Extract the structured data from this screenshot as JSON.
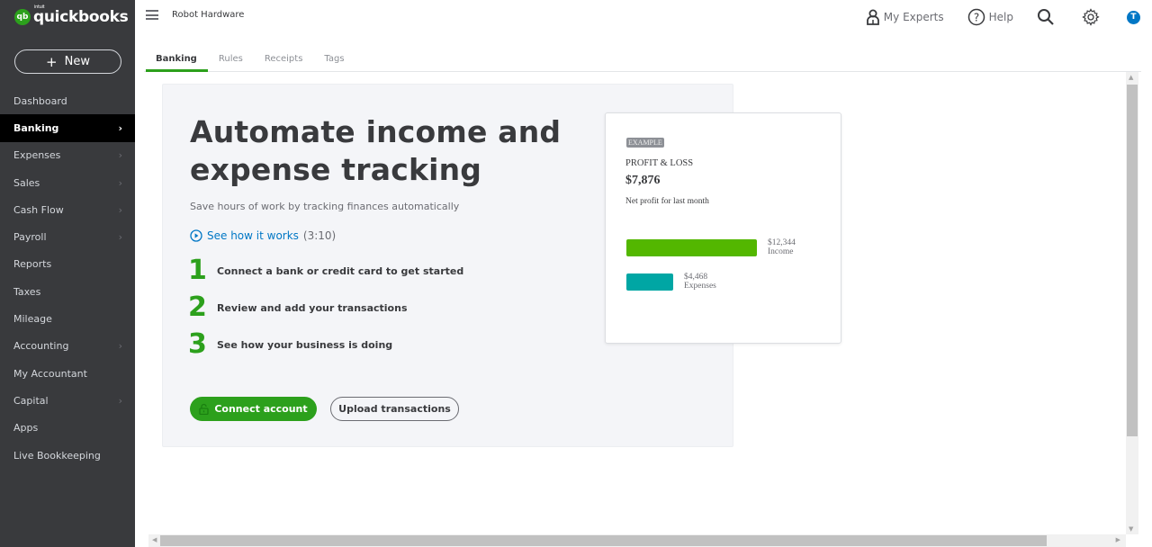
{
  "brand": {
    "logo_mark": "qb",
    "intuit": "intuit",
    "name": "quickbooks",
    "accent": "#2ca01c"
  },
  "sidebar": {
    "new_button": {
      "icon": "plus-icon",
      "label": "New"
    },
    "items": [
      {
        "label": "Dashboard",
        "chevron": false,
        "active": false
      },
      {
        "label": "Banking",
        "chevron": true,
        "active": true
      },
      {
        "label": "Expenses",
        "chevron": true,
        "active": false
      },
      {
        "label": "Sales",
        "chevron": true,
        "active": false
      },
      {
        "label": "Cash Flow",
        "chevron": true,
        "active": false
      },
      {
        "label": "Payroll",
        "chevron": true,
        "active": false
      },
      {
        "label": "Reports",
        "chevron": false,
        "active": false
      },
      {
        "label": "Taxes",
        "chevron": false,
        "active": false
      },
      {
        "label": "Mileage",
        "chevron": false,
        "active": false
      },
      {
        "label": "Accounting",
        "chevron": true,
        "active": false
      },
      {
        "label": "My Accountant",
        "chevron": false,
        "active": false
      },
      {
        "label": "Capital",
        "chevron": true,
        "active": false
      },
      {
        "label": "Apps",
        "chevron": false,
        "active": false
      },
      {
        "label": "Live Bookkeeping",
        "chevron": false,
        "active": false
      }
    ]
  },
  "topbar": {
    "company": "Robot Hardware",
    "my_experts": "My Experts",
    "help": "Help",
    "avatar_initial": "T"
  },
  "tabs": [
    {
      "label": "Banking",
      "active": true
    },
    {
      "label": "Rules",
      "active": false
    },
    {
      "label": "Receipts",
      "active": false
    },
    {
      "label": "Tags",
      "active": false
    }
  ],
  "hero": {
    "title_line1": "Automate income and",
    "title_line2": "expense tracking",
    "subtitle": "Save hours of work by tracking finances automatically",
    "video_label": "See how it works",
    "video_duration": "(3:10)",
    "steps": [
      {
        "num": "1",
        "text": "Connect a bank or credit card to get started"
      },
      {
        "num": "2",
        "text": "Review and add your transactions"
      },
      {
        "num": "3",
        "text": "See how your business is doing"
      }
    ],
    "connect_label": "Connect account",
    "upload_label": "Upload transactions"
  },
  "pl_card": {
    "badge": "EXAMPLE",
    "title": "PROFIT & LOSS",
    "amount": "$7,876",
    "description": "Net profit for last month",
    "income": {
      "amount": "$12,344",
      "label": "Income",
      "value": 12344,
      "color": "#53b700"
    },
    "expenses": {
      "amount": "$4,468",
      "label": "Expenses",
      "value": 4468,
      "color": "#00a6a4"
    }
  }
}
